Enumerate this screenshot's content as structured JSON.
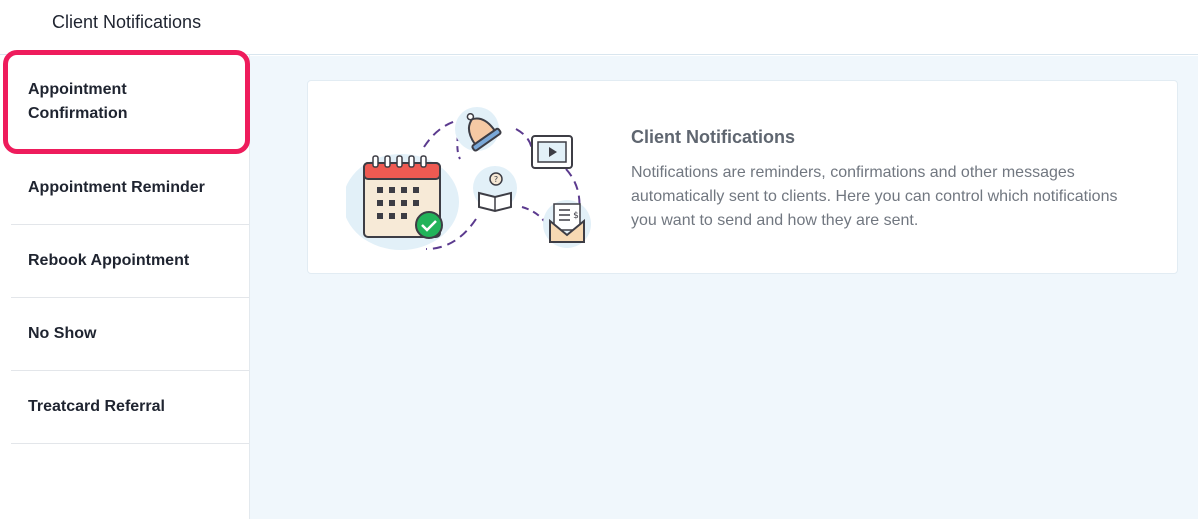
{
  "header": {
    "title": "Client Notifications"
  },
  "sidebar": {
    "items": [
      {
        "label": "Appointment Confirmation",
        "active": true
      },
      {
        "label": "Appointment Reminder"
      },
      {
        "label": "Rebook Appointment"
      },
      {
        "label": "No Show"
      },
      {
        "label": "Treatcard Referral"
      }
    ]
  },
  "card": {
    "title": "Client Notifications",
    "description": "Notifications are reminders, confirmations and other messages automatically sent to clients. Here you can control which notifications you want to send and how they are sent.",
    "illustration_icons": [
      "calendar-icon",
      "check-icon",
      "bell-icon",
      "video-icon",
      "book-icon",
      "envelope-icon"
    ]
  },
  "colors": {
    "accent": "#ee1c5c",
    "main_bg": "#f0f7fc",
    "calendar_red": "#ef5a52",
    "check_green": "#22b35a",
    "blob": "#e2f0f8",
    "dash": "#5b3a8e"
  }
}
